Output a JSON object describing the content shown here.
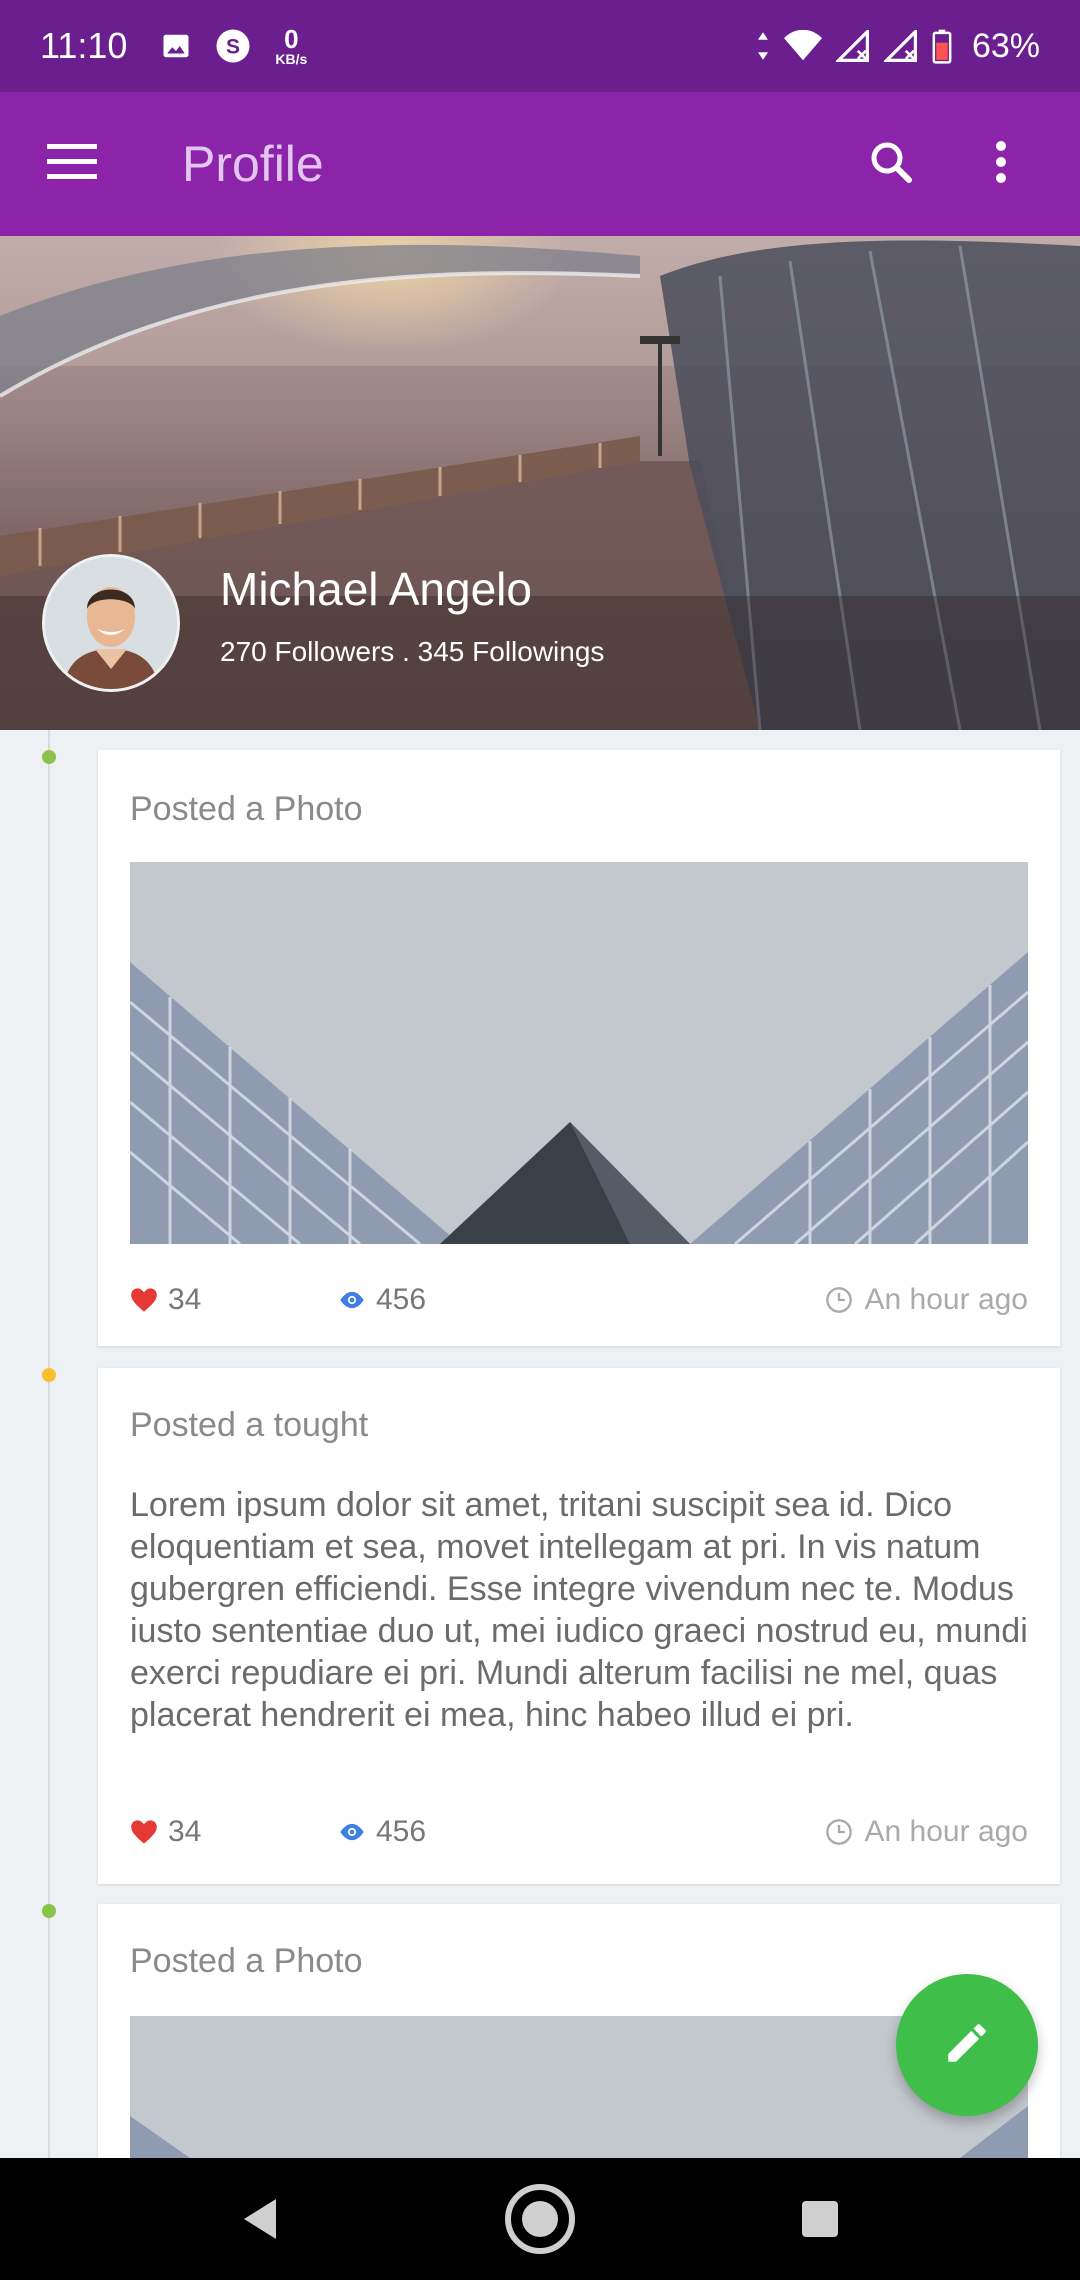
{
  "status_bar": {
    "time": "11:10",
    "net_speed_value": "0",
    "net_speed_unit": "KB/s",
    "battery": "63%",
    "icons": [
      "image-icon",
      "skype-icon",
      "data-arrows-icon",
      "wifi-icon",
      "signal-icon",
      "signal-icon",
      "battery-icon"
    ]
  },
  "app_bar": {
    "title": "Profile",
    "icons": [
      "menu-icon",
      "search-icon",
      "more-vert-icon"
    ]
  },
  "profile": {
    "name": "Michael Angelo",
    "stats": "270 Followers . 345 Followings"
  },
  "timeline": {
    "dot_colors": [
      "#8bc34a",
      "#fbc02d",
      "#8bc34a"
    ]
  },
  "posts": [
    {
      "type": "Posted a Photo",
      "likes": "34",
      "views": "456",
      "time": "An hour ago"
    },
    {
      "type": "Posted a tought",
      "body": "Lorem ipsum dolor sit amet, tritani suscipit sea id. Dico eloquentiam et sea, movet intellegam at pri. In vis natum gubergren efficiendi. Esse integre vivendum nec te. Modus iusto sententiae duo ut, mei iudico graeci nostrud eu, mundi exerci repudiare ei pri. Mundi alterum facilisi ne mel, quas placerat hendrerit ei mea, hinc habeo illud ei pri.",
      "likes": "34",
      "views": "456",
      "time": "An hour ago"
    },
    {
      "type": "Posted a Photo"
    }
  ],
  "colors": {
    "status_bar": "#6b1f8f",
    "app_bar": "#8b24a8",
    "fab": "#3fbf4a",
    "like": "#e53935",
    "views": "#3f7fe0"
  },
  "fab": {
    "icon": "pencil-icon"
  },
  "nav_bar": {
    "icons": [
      "back-icon",
      "home-icon",
      "recents-icon"
    ]
  }
}
